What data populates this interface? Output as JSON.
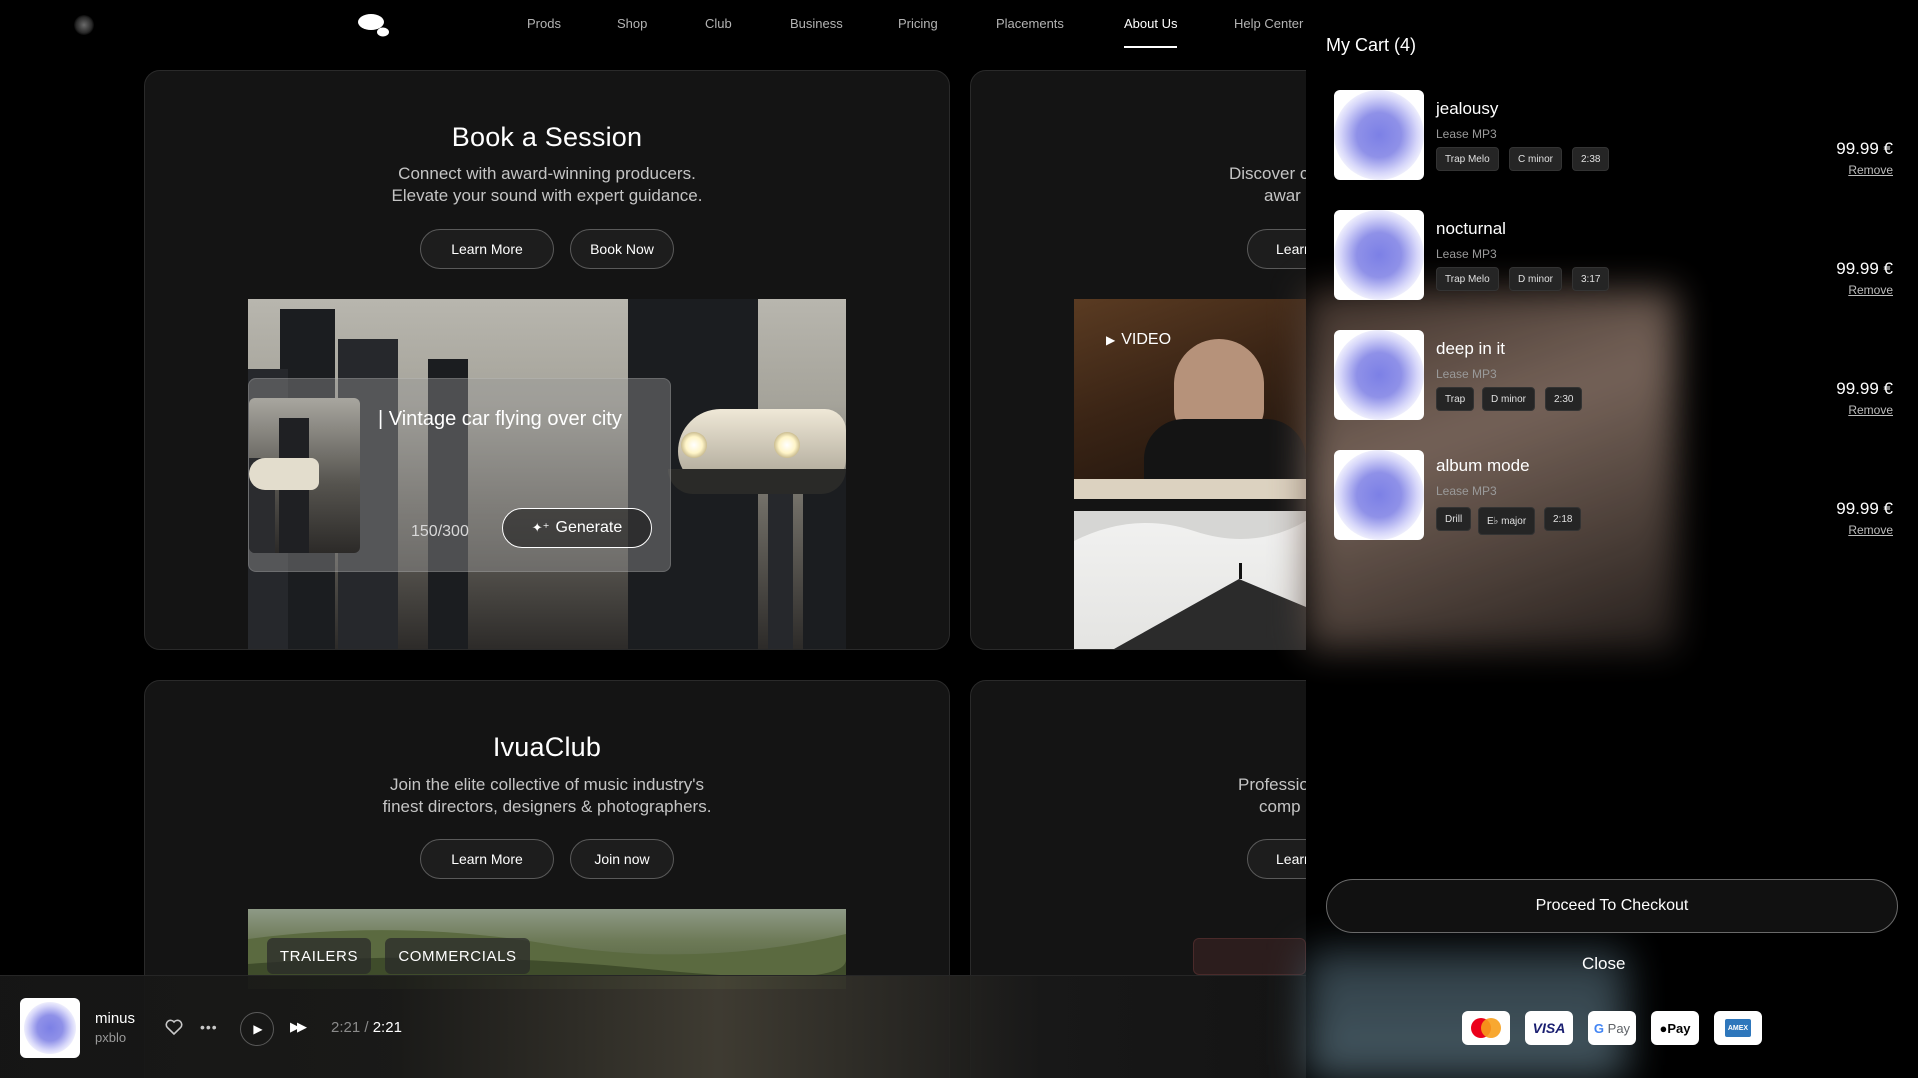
{
  "nav": {
    "items": [
      "Prods",
      "Shop",
      "Club",
      "Business",
      "Pricing",
      "Placements",
      "About Us",
      "Help Center"
    ],
    "active": "About Us"
  },
  "cards": {
    "session": {
      "title": "Book a Session",
      "desc_line1": "Connect with award-winning producers.",
      "desc_line2": "Elevate your sound with expert guidance.",
      "btn_learn": "Learn More",
      "btn_primary": "Book Now",
      "prompt": "| Vintage car flying over city",
      "counter": "150/300",
      "generate": "Generate"
    },
    "discover": {
      "desc_line1": "Discover c",
      "desc_line2": "awar",
      "btn_learn": "Learn",
      "video_tag": "VIDEO"
    },
    "club": {
      "title": "IvuaClub",
      "desc_line1": "Join the elite collective of music industry's",
      "desc_line2": "finest directors, designers & photographers.",
      "btn_learn": "Learn More",
      "btn_primary": "Join now",
      "tags": [
        "TRAILERS",
        "COMMERCIALS"
      ]
    },
    "professional": {
      "desc_line1": "Professio",
      "desc_line2": "comp",
      "btn_learn": "Learn"
    }
  },
  "player": {
    "title": "minus",
    "artist": "pxblo",
    "current": "2:21",
    "separator": "/",
    "total": "2:21"
  },
  "cart": {
    "title": "My Cart (4)",
    "items": [
      {
        "name": "jealousy",
        "license": "Lease MP3",
        "genre": "Trap Melo",
        "key": "C minor",
        "duration": "2:38",
        "price": "99.99 €",
        "remove": "Remove"
      },
      {
        "name": "nocturnal",
        "license": "Lease MP3",
        "genre": "Trap Melo",
        "key": "D minor",
        "duration": "3:17",
        "price": "99.99 €",
        "remove": "Remove"
      },
      {
        "name": "deep in it",
        "license": "Lease MP3",
        "genre": "Trap",
        "key": "D minor",
        "duration": "2:30",
        "price": "99.99 €",
        "remove": "Remove"
      },
      {
        "name": "album mode",
        "license": "Lease MP3",
        "genre": "Drill",
        "key": "E♭ major",
        "duration": "2:18",
        "price": "99.99 €",
        "remove": "Remove"
      }
    ],
    "checkout": "Proceed To Checkout",
    "close": "Close",
    "payments": [
      "mastercard",
      "visa",
      "gpay",
      "applepay",
      "amex"
    ]
  },
  "colors": {
    "background": "#000000",
    "card": "#141414",
    "artwork_blob": "#7c80e6"
  }
}
